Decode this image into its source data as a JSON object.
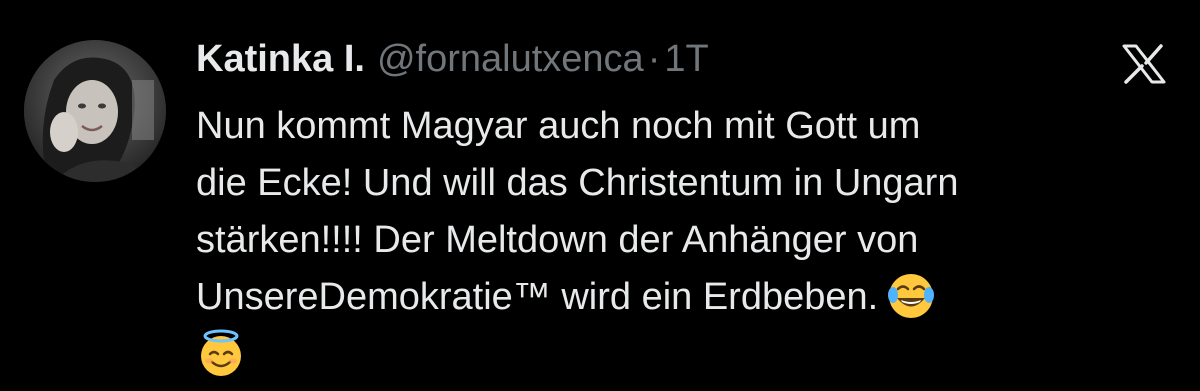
{
  "tweet": {
    "display_name": "Katinka I.",
    "handle": "@fornalutxenca",
    "separator": "·",
    "time": "1T",
    "lines": [
      "Nun kommt Magyar auch noch mit Gott um",
      "die Ecke! Und will das Christentum in Ungarn",
      "stärken!!!! Der Meltdown der Anhänger von",
      "UnsereDemokratie™ wird ein Erdbeben."
    ],
    "emojis": [
      "face-with-tears-of-joy-icon",
      "smiling-face-with-halo-icon"
    ]
  },
  "colors": {
    "background": "#000000",
    "text_primary": "#e7e9ea",
    "text_secondary": "#71767b"
  },
  "icons": {
    "platform": "x-logo-icon",
    "avatar": "profile-photo"
  }
}
